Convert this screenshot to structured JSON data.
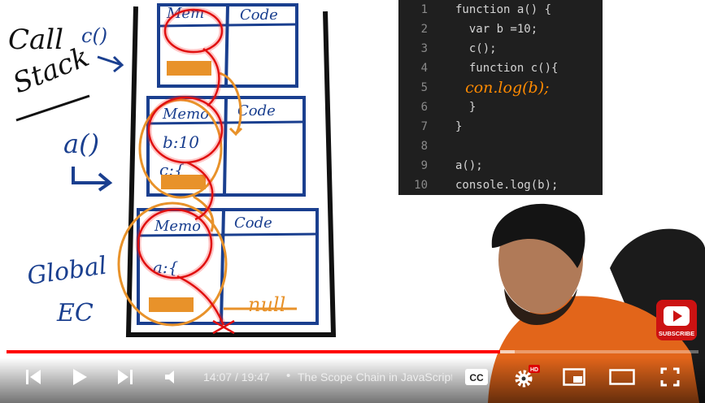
{
  "drawing": {
    "call_stack_label_line1": "Call",
    "call_stack_label_line2": "Stack",
    "call_stack_fn": "c()",
    "a_label": "a()",
    "global_label_line1": "Global",
    "global_label_line2": "EC",
    "memory_label": "Memory",
    "memory_label_short": "Mem",
    "memory_label_clip": "Memo",
    "code_label": "Code",
    "b_value": "b:10",
    "c_value": "c:{",
    "a_value": "a:{",
    "null_label": "null"
  },
  "code": {
    "lines": [
      {
        "n": "1",
        "text": "function a() {"
      },
      {
        "n": "2",
        "text": "  var b =10;"
      },
      {
        "n": "3",
        "text": "  c();"
      },
      {
        "n": "4",
        "text": "  function c(){"
      },
      {
        "n": "5",
        "text": "  con.log(b);"
      },
      {
        "n": "6",
        "text": "  }"
      },
      {
        "n": "7",
        "text": "}"
      },
      {
        "n": "8",
        "text": ""
      },
      {
        "n": "9",
        "text": "a();"
      },
      {
        "n": "10",
        "text": "console.log(b);"
      }
    ]
  },
  "player": {
    "current_time": "14:07",
    "duration": "19:47",
    "time_sep": "/",
    "title_sep": "•",
    "chapter_title": "The Scope Chain in JavaScript",
    "progress_played": 0.713,
    "progress_buffered_end": 0.735,
    "hd_badge": "HD",
    "subscribe_label": "SUBSCRIBE",
    "colors": {
      "accent": "#ff0000",
      "marker_blue": "#1a3f8f",
      "marker_orange": "#e8922a"
    }
  }
}
